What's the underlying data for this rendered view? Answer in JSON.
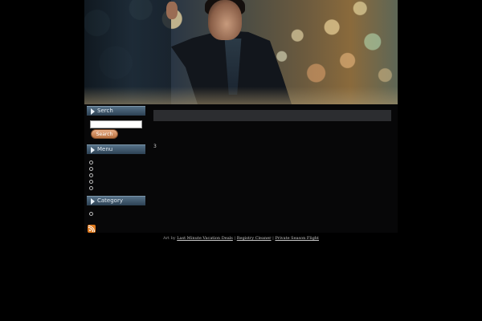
{
  "sidebar": {
    "search_heading": "Serch",
    "search_placeholder": "",
    "search_button": "Search",
    "menu_heading": "Menu",
    "menu_item_count": 5,
    "category_heading": "Category",
    "category_item_count": 1
  },
  "content": {
    "number": "3"
  },
  "footer": {
    "prefix": "Art by",
    "link1": "Last Minute Vacation Deals",
    "sep1": "|",
    "link2": "Registry Cleaner",
    "sep2": "|",
    "link3": "Private Season Flight"
  },
  "colors": {
    "page_bg": "#000000",
    "panel_bg": "#070708",
    "sidebar_header": "#3e576b",
    "search_button": "#d18a5a",
    "content_bar": "#2c2d30",
    "rss": "#e07a1e"
  },
  "icons": [
    "arrow-right-icon",
    "rss-icon"
  ]
}
